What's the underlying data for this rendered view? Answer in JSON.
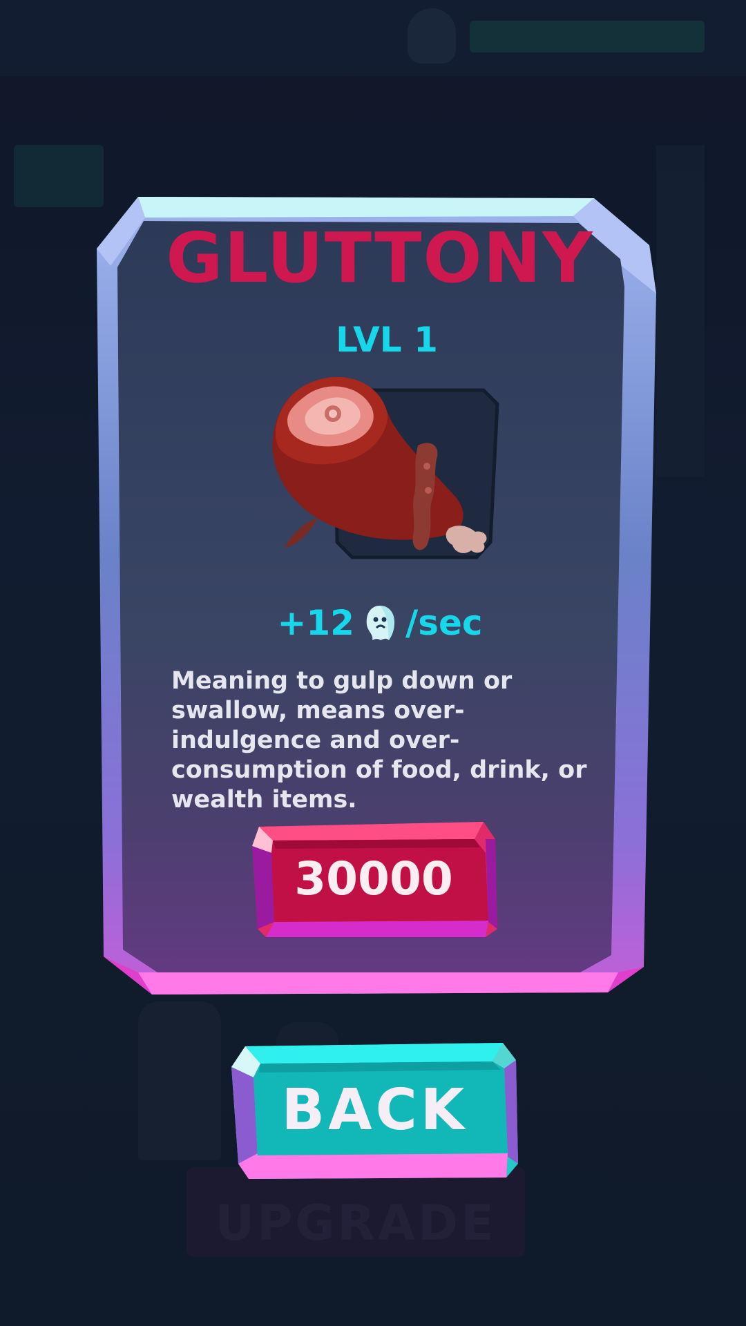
{
  "card": {
    "title": "GLUTTONY",
    "level": "LVL 1",
    "item_icon": "meat-leg-icon",
    "rate": {
      "amount": "+12",
      "currency_icon": "ghost-icon",
      "unit": "/sec"
    },
    "description": "Meaning to gulp down or swallow, means over-indulgence and over-consumption of food, drink, or wealth items.",
    "price": "30000"
  },
  "buttons": {
    "back_label": "BACK"
  },
  "background": {
    "upgrade_label": "UPGRADE"
  },
  "colors": {
    "title": "#d01850",
    "accent_cyan": "#17d8ea",
    "price_button": "#c01045",
    "back_button": "#12b7b8",
    "frame_top": "#c8f6f8",
    "frame_bottom": "#ff7ae8"
  }
}
